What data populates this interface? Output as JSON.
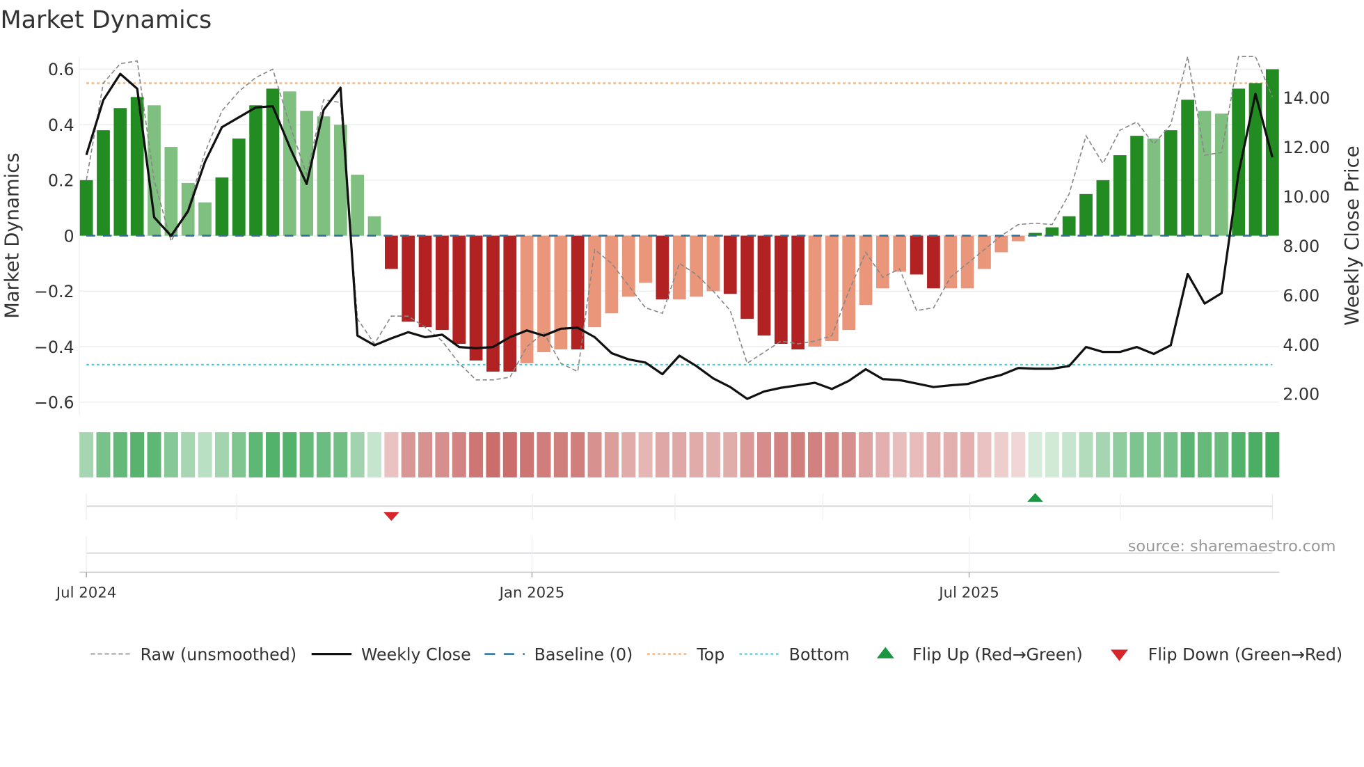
{
  "chart_data": {
    "type": "bar",
    "title": "Market Dynamics",
    "ylabel": "Market Dynamics",
    "y2label": "Weekly Close Price",
    "ylim": [
      -0.65,
      0.65
    ],
    "y2lim": [
      1.5,
      15.3
    ],
    "yticks": [
      "0.6",
      "0.4",
      "0.2",
      "0",
      "−0.2",
      "−0.4",
      "−0.6"
    ],
    "ytick_values": [
      0.6,
      0.4,
      0.2,
      0,
      -0.2,
      -0.4,
      -0.6
    ],
    "y2ticks": [
      "14.00",
      "12.00",
      "10.00",
      "8.00",
      "6.00",
      "4.00",
      "2.00"
    ],
    "y2tick_values": [
      14,
      12,
      10,
      8,
      6,
      4,
      2
    ],
    "xticks": [
      {
        "label": "Jul 2024",
        "index": 0
      },
      {
        "label": "Jan 2025",
        "index": 26.3
      },
      {
        "label": "Jul 2025",
        "index": 52.1
      }
    ],
    "top_level": 0.55,
    "bottom_level": -0.465,
    "baseline": 0,
    "dynamics": [
      0.2,
      0.38,
      0.46,
      0.5,
      0.47,
      0.32,
      0.19,
      0.12,
      0.21,
      0.35,
      0.47,
      0.53,
      0.52,
      0.45,
      0.43,
      0.4,
      0.22,
      0.07,
      -0.12,
      -0.31,
      -0.33,
      -0.34,
      -0.39,
      -0.45,
      -0.49,
      -0.49,
      -0.46,
      -0.42,
      -0.41,
      -0.41,
      -0.33,
      -0.28,
      -0.22,
      -0.17,
      -0.23,
      -0.23,
      -0.22,
      -0.2,
      -0.21,
      -0.3,
      -0.36,
      -0.39,
      -0.41,
      -0.4,
      -0.38,
      -0.34,
      -0.25,
      -0.19,
      -0.13,
      -0.14,
      -0.19,
      -0.19,
      -0.19,
      -0.12,
      -0.06,
      -0.02,
      0.01,
      0.03,
      0.07,
      0.15,
      0.2,
      0.29,
      0.36,
      0.35,
      0.38,
      0.49,
      0.45,
      0.44,
      0.53,
      0.55,
      0.6
    ],
    "shade": [
      "d",
      "d",
      "d",
      "d",
      "l",
      "l",
      "l",
      "l",
      "d",
      "d",
      "d",
      "d",
      "l",
      "l",
      "l",
      "l",
      "l",
      "l",
      "d",
      "d",
      "d",
      "d",
      "d",
      "d",
      "d",
      "d",
      "l",
      "l",
      "l",
      "d",
      "l",
      "l",
      "l",
      "l",
      "d",
      "l",
      "l",
      "l",
      "d",
      "d",
      "d",
      "d",
      "d",
      "l",
      "l",
      "l",
      "l",
      "l",
      "l",
      "d",
      "d",
      "l",
      "l",
      "l",
      "l",
      "l",
      "d",
      "d",
      "d",
      "d",
      "d",
      "d",
      "d",
      "l",
      "d",
      "d",
      "l",
      "l",
      "d",
      "d",
      "d"
    ],
    "raw": [
      0.2,
      0.55,
      0.62,
      0.63,
      0.2,
      -0.02,
      0.1,
      0.3,
      0.45,
      0.52,
      0.57,
      0.6,
      0.4,
      0.22,
      0.49,
      0.48,
      -0.3,
      -0.39,
      -0.29,
      -0.29,
      -0.33,
      -0.38,
      -0.46,
      -0.52,
      -0.52,
      -0.51,
      -0.4,
      -0.35,
      -0.46,
      -0.49,
      -0.05,
      -0.1,
      -0.18,
      -0.26,
      -0.28,
      -0.1,
      -0.14,
      -0.2,
      -0.27,
      -0.46,
      -0.42,
      -0.38,
      -0.39,
      -0.38,
      -0.36,
      -0.2,
      -0.06,
      -0.15,
      -0.12,
      -0.27,
      -0.26,
      -0.15,
      -0.1,
      -0.05,
      0.0,
      0.04,
      0.045,
      0.04,
      0.15,
      0.36,
      0.26,
      0.38,
      0.41,
      0.33,
      0.4,
      0.66,
      0.29,
      0.3,
      0.66,
      0.66,
      0.5
    ],
    "weekly_close": [
      11.68,
      13.9,
      14.96,
      14.36,
      9.15,
      8.4,
      9.4,
      11.4,
      12.8,
      13.2,
      13.6,
      13.65,
      12.0,
      10.5,
      13.5,
      14.4,
      4.36,
      3.97,
      4.25,
      4.5,
      4.3,
      4.4,
      3.9,
      3.85,
      3.9,
      4.3,
      4.57,
      4.36,
      4.64,
      4.68,
      4.3,
      3.65,
      3.4,
      3.27,
      2.8,
      3.55,
      3.13,
      2.63,
      2.28,
      1.8,
      2.1,
      2.25,
      2.35,
      2.45,
      2.2,
      2.53,
      3.0,
      2.6,
      2.56,
      2.42,
      2.28,
      2.35,
      2.4,
      2.6,
      2.77,
      3.05,
      3.02,
      3.02,
      3.13,
      3.9,
      3.7,
      3.7,
      3.9,
      3.62,
      3.97,
      6.86,
      5.66,
      6.08,
      10.94,
      14.15,
      11.58
    ],
    "flip_down_indices": [
      18
    ],
    "flip_up_indices": [
      56
    ],
    "legend": [
      {
        "label": "Raw (unsmoothed)",
        "kind": "raw"
      },
      {
        "label": "Weekly Close",
        "kind": "close"
      },
      {
        "label": "Baseline (0)",
        "kind": "baseline"
      },
      {
        "label": "Top",
        "kind": "top"
      },
      {
        "label": "Bottom",
        "kind": "bottom"
      },
      {
        "label": "Flip Up (Red→Green)",
        "kind": "flipup"
      },
      {
        "label": "Flip Down (Green→Red)",
        "kind": "flipdown"
      }
    ],
    "legend_position": "bottom",
    "source": "source: sharemaestro.com",
    "colors": {
      "green_dark": "#228b22",
      "green_light": "#7fbf7f",
      "red_dark": "#b22222",
      "red_light": "#e9967a",
      "baseline": "#2b6f9a",
      "top": "#f4a261",
      "bottom": "#3cc8d8",
      "flip_up": "#1a9641",
      "flip_down": "#d7262b",
      "strip_green": "#3aa655",
      "strip_red": "#c0504d"
    }
  }
}
